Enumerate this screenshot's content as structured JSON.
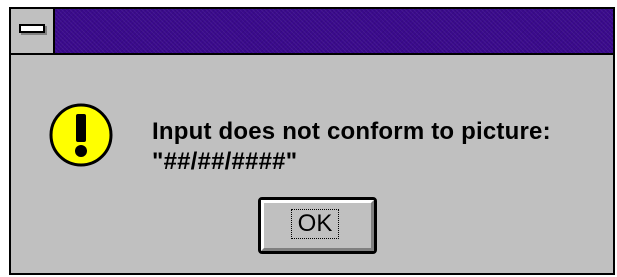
{
  "dialog": {
    "title": "",
    "message_line1": "Input does not conform to picture:",
    "message_line2": "\"##/##/####\"",
    "icon": "exclamation-icon",
    "ok_label": "OK"
  },
  "colors": {
    "titlebar": "#3a0a8c",
    "face": "#c0c0c0",
    "icon_fill": "#ffff00"
  }
}
